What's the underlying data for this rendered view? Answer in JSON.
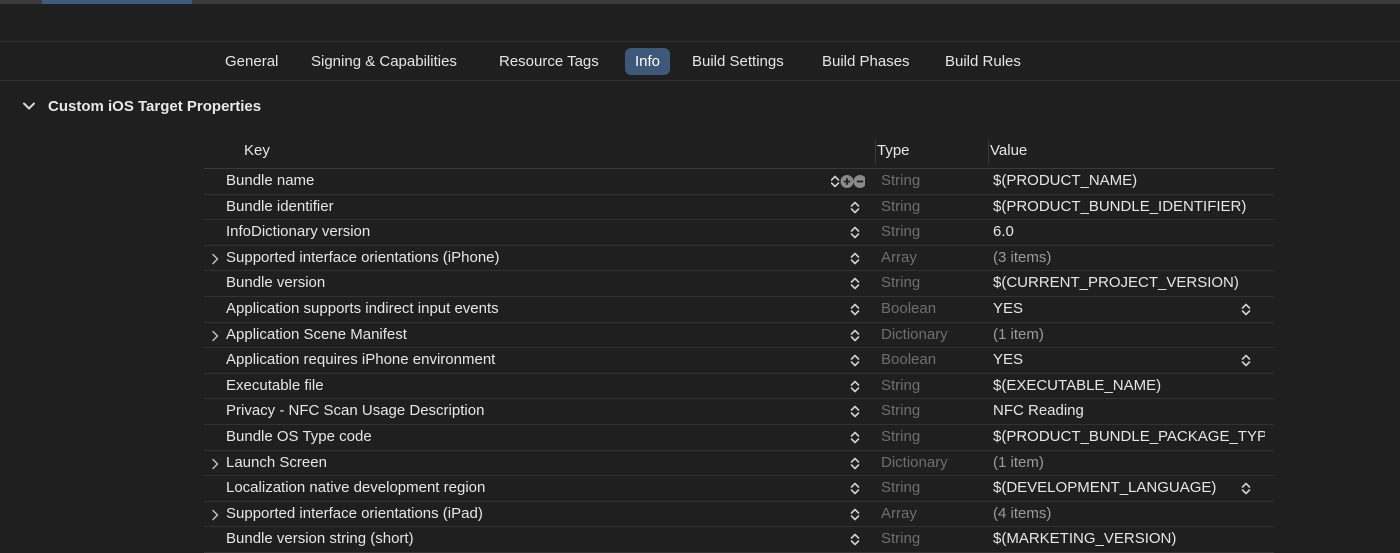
{
  "tabs": [
    {
      "label": "General",
      "selected": false
    },
    {
      "label": "Signing & Capabilities",
      "selected": false
    },
    {
      "label": "Resource Tags",
      "selected": false
    },
    {
      "label": "Info",
      "selected": true
    },
    {
      "label": "Build Settings",
      "selected": false
    },
    {
      "label": "Build Phases",
      "selected": false
    },
    {
      "label": "Build Rules",
      "selected": false
    }
  ],
  "section": {
    "title": "Custom iOS Target Properties",
    "expanded": true
  },
  "table": {
    "headers": {
      "key": "Key",
      "type": "Type",
      "value": "Value"
    },
    "rows": [
      {
        "key": "Bundle name",
        "type": "String",
        "value": "$(PRODUCT_NAME)"
      },
      {
        "key": "Bundle identifier",
        "type": "String",
        "value": "$(PRODUCT_BUNDLE_IDENTIFIER)"
      },
      {
        "key": "InfoDictionary version",
        "type": "String",
        "value": "6.0"
      },
      {
        "key": "Supported interface orientations (iPhone)",
        "type": "Array",
        "value": "(3 items)",
        "expandable": true
      },
      {
        "key": "Bundle version",
        "type": "String",
        "value": "$(CURRENT_PROJECT_VERSION)"
      },
      {
        "key": "Application supports indirect input events",
        "type": "Boolean",
        "value": "YES",
        "value_popup": true
      },
      {
        "key": "Application Scene Manifest",
        "type": "Dictionary",
        "value": "(1 item)",
        "expandable": true
      },
      {
        "key": "Application requires iPhone environment",
        "type": "Boolean",
        "value": "YES",
        "value_popup": true
      },
      {
        "key": "Executable file",
        "type": "String",
        "value": "$(EXECUTABLE_NAME)"
      },
      {
        "key": "Privacy - NFC Scan Usage Description",
        "type": "String",
        "value": "NFC Reading"
      },
      {
        "key": "Bundle OS Type code",
        "type": "String",
        "value": "$(PRODUCT_BUNDLE_PACKAGE_TYP"
      },
      {
        "key": "Launch Screen",
        "type": "Dictionary",
        "value": "(1 item)",
        "expandable": true
      },
      {
        "key": "Localization native development region",
        "type": "String",
        "value": "$(DEVELOPMENT_LANGUAGE)",
        "value_popup": true
      },
      {
        "key": "Supported interface orientations (iPad)",
        "type": "Array",
        "value": "(4 items)",
        "expandable": true
      },
      {
        "key": "Bundle version string (short)",
        "type": "String",
        "value": "$(MARKETING_VERSION)"
      }
    ]
  },
  "colors": {
    "selected_tab": "#3e5879",
    "background": "#1f1f1f",
    "muted_type": "#6e6e6e"
  }
}
